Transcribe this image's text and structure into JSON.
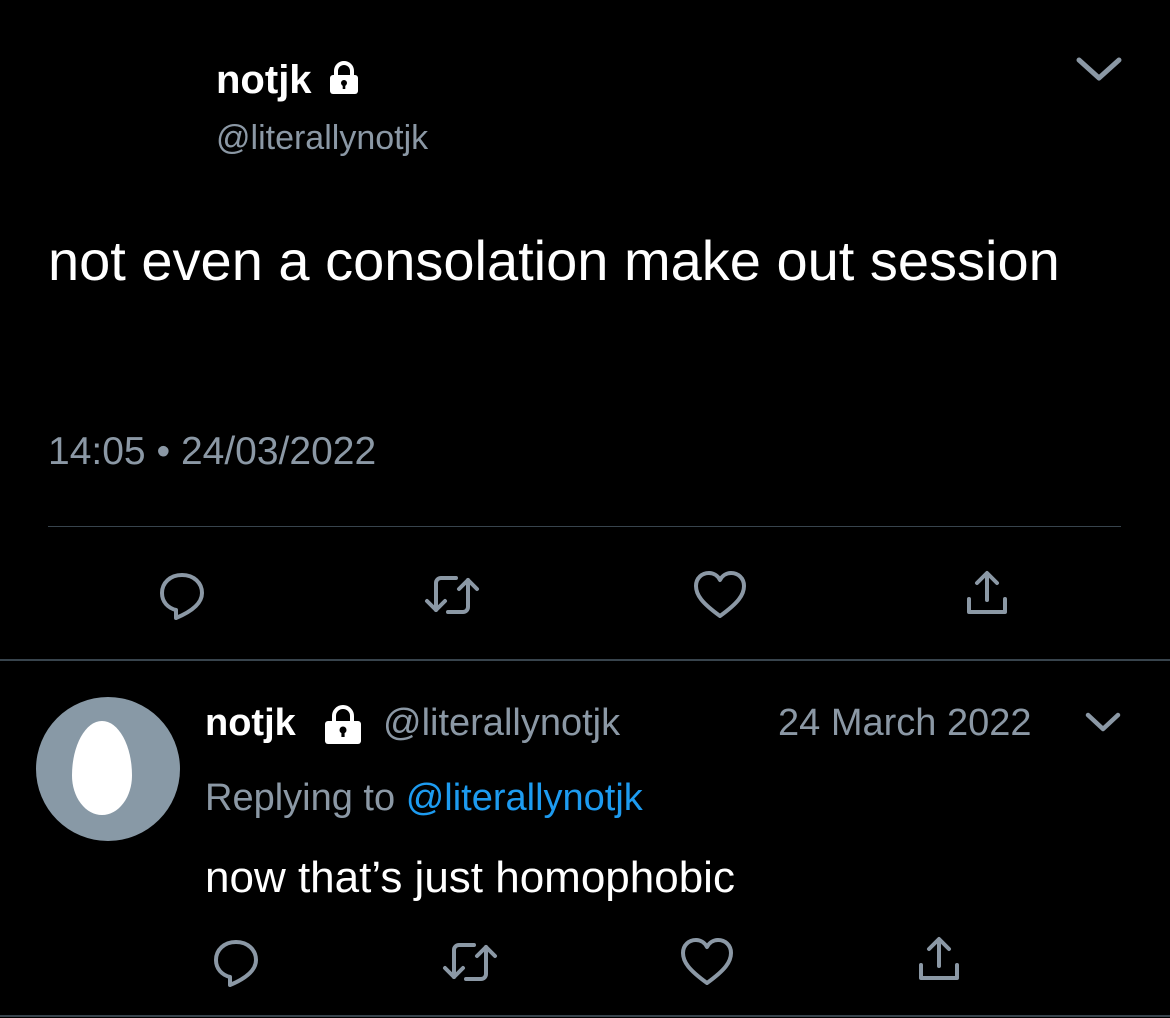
{
  "main_tweet": {
    "name": "notjk",
    "handle": "@literallynotjk",
    "text": "not even a consolation make out session",
    "time": "14:05",
    "separator": "•",
    "date": "24/03/2022"
  },
  "reply_tweet": {
    "name": "notjk",
    "handle": "@literallynotjk",
    "date": "24 March 2022",
    "replying_prefix": "Replying to",
    "replying_handle": "@literallynotjk",
    "text": "now that’s just homophobic"
  },
  "icons": [
    "lock-icon",
    "chevron-down-icon",
    "reply-icon",
    "retweet-icon",
    "like-icon",
    "share-icon"
  ],
  "colors": {
    "background": "#000000",
    "muted": "#8b98a5",
    "link": "#1d9bf0",
    "divider": "#38444d",
    "avatar": "#8899a6"
  }
}
